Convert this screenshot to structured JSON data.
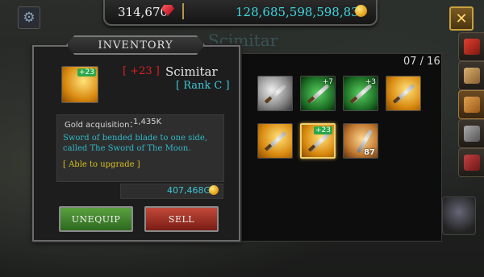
{
  "currency": {
    "rubies": "314,670",
    "gold": "128,685,598,598,839"
  },
  "background_title": "Scimitar",
  "inventory": {
    "title": "INVENTORY",
    "slot_count": "07 / 16",
    "selected_item": {
      "upgrade_level": "[ +23 ]",
      "icon_badge": "+23",
      "name": "Scimitar",
      "rank": "[ Rank C ]",
      "gold_acquisition_label": "Gold acquisition：",
      "gold_acquisition_value": "1,435K",
      "description": "Sword of bended blade to one side, called The Sword of The Moon.",
      "upgrade_note": "[ Able to upgrade ]",
      "sell_price": "407,468G"
    },
    "buttons": {
      "unequip": "UNEQUIP",
      "sell": "SELL"
    },
    "items": [
      {
        "icon": "axe-icon",
        "badge": ""
      },
      {
        "icon": "green-sword-icon",
        "badge": "+7"
      },
      {
        "icon": "green-sword-icon",
        "badge": "+3"
      },
      {
        "icon": "gold-sword-icon",
        "badge": ""
      },
      {
        "icon": "gold-sword-icon",
        "badge": ""
      },
      {
        "icon": "scimitar-icon",
        "badge": "+23"
      },
      {
        "icon": "stone-icon",
        "badge": "87"
      }
    ]
  },
  "colors": {
    "accent_cyan": "#3fc6d6",
    "rank_red": "#e02020",
    "upgrade_yellow": "#d8c020",
    "unequip_green": "#5aa040",
    "sell_red": "#c24a3a"
  }
}
